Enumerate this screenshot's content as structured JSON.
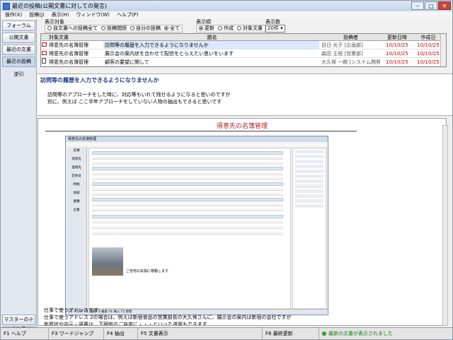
{
  "window": {
    "title": "最近の投稿(公開文書に対しての発言)"
  },
  "menu": [
    "操作(X)",
    "投稿(J)",
    "表示(H)",
    "ウィンドウ(W)",
    "ヘルプ(P)"
  ],
  "leftnav": {
    "buttons": [
      "フォーラム",
      "公開文書",
      "最近の文書",
      "最近の投稿"
    ],
    "items": [
      "逆引"
    ],
    "bottom": [
      "マスターのテナンス",
      "運用"
    ]
  },
  "filters": {
    "target": {
      "label": "表示対象",
      "options": [
        "自文書への投稿全て",
        "投稿閲読",
        "自分の投稿",
        "全て"
      ],
      "selected": 3
    },
    "order": {
      "label": "表示順",
      "options": [
        "更新",
        "作成",
        "対象文書"
      ],
      "selected": 0
    },
    "count": {
      "label": "表示数",
      "value": "20件"
    }
  },
  "grid": {
    "columns": {
      "target": "対象文書",
      "title": "題名",
      "poster": "投稿者",
      "updated": "更新日時",
      "created": "作成日"
    },
    "rows": [
      {
        "icon": "mail-icon",
        "target": "得意先の名簿管理",
        "title": "訪問等の履歴を入力できるようになりませんか",
        "poster": "目日 光子 [企画部]",
        "updated": "10/10/25",
        "created": "10/10/25"
      },
      {
        "icon": "mail-icon",
        "target": "得意先の名簿管理",
        "title": "展示会の案内状を合わせて配信をとらえたい思いをいます",
        "poster": "森田 主税 [営業部]",
        "updated": "10/10/25",
        "created": "10/10/25"
      },
      {
        "icon": "doc-icon",
        "target": "得意先の名簿管理",
        "title": "顧客の要望に関して",
        "poster": "大久保 一朗 [システム開発部]",
        "updated": "10/10/25",
        "created": "10/10/25"
      }
    ]
  },
  "message": {
    "subject": "訪問等の履歴を入力できるようになりませんか",
    "body": "訪問等のアプローチをした時に、対応等もいれて残せるようになると思いのですが\n別に、例えば ここ半年アプローチをしていない人物の抽出もできると思いです"
  },
  "document": {
    "title": "得意先の名簿管理",
    "text": "仕事で使うアドレスです\n仕事で使うアドレス 2の場合は、例えば新宿食品の営業部長の大久保さんに、展示会の案内は新宿の会社ですが\n年賀状や中元・歳暮は、下宿宛のご自宅に・・・といった運用もできます",
    "embedded": {
      "title": "得意先の名簿管理",
      "caption": "ご自宅の玄関に移動します",
      "nav": [
        "名簿",
        "得意先",
        "連絡先",
        "定休日",
        "時間",
        "地域",
        "業種",
        "企業"
      ],
      "status": "F1 ヘルプ     F2 印刷     F3 検索     F4 挿入     F5 更新"
    }
  },
  "status": {
    "segments": [
      "F1 ヘルプ",
      "F3 ワードジャンプ",
      "F4 抽出",
      "F5 文書表示",
      "F8 最終更新"
    ],
    "message": "最新の文書が表示されました"
  },
  "colors": {
    "accent": "#1a3a8a",
    "date": "#c00000",
    "ok": "#1a7a1a"
  }
}
